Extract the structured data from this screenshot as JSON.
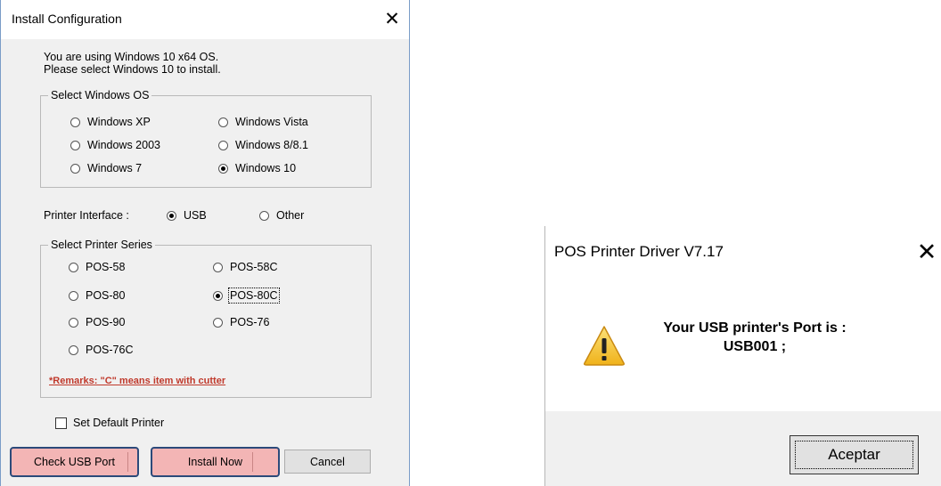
{
  "install_dialog": {
    "title": "Install Configuration",
    "close_glyph": "✕",
    "info_line1": "You are using Windows 10 x64 OS.",
    "info_line2": "Please select Windows 10 to install.",
    "os_group": {
      "legend": "Select Windows OS",
      "options": [
        {
          "label": "Windows XP",
          "selected": false
        },
        {
          "label": "Windows Vista",
          "selected": false
        },
        {
          "label": "Windows 2003",
          "selected": false
        },
        {
          "label": "Windows 8/8.1",
          "selected": false
        },
        {
          "label": "Windows 7",
          "selected": false
        },
        {
          "label": "Windows 10",
          "selected": true
        }
      ]
    },
    "printer_interface": {
      "label": "Printer Interface :",
      "options": [
        {
          "label": "USB",
          "selected": true
        },
        {
          "label": "Other",
          "selected": false
        }
      ]
    },
    "series_group": {
      "legend": "Select Printer Series",
      "options": [
        {
          "label": "POS-58",
          "selected": false
        },
        {
          "label": "POS-58C",
          "selected": false
        },
        {
          "label": "POS-80",
          "selected": false
        },
        {
          "label": "POS-80C",
          "selected": true
        },
        {
          "label": "POS-90",
          "selected": false
        },
        {
          "label": "POS-76",
          "selected": false
        },
        {
          "label": "POS-76C",
          "selected": false
        }
      ],
      "remark": "*Remarks: \"C\" means item with cutter"
    },
    "default_printer": {
      "label": "Set Default Printer",
      "checked": false
    },
    "buttons": {
      "check_usb": "Check USB Port",
      "install_now": "Install Now",
      "cancel": "Cancel"
    }
  },
  "driver_dialog": {
    "title": "POS Printer Driver V7.17",
    "close_glyph": "✕",
    "message_line1": "Your USB printer's Port is :",
    "message_line2": "USB001 ;",
    "icon": "warning-icon",
    "ok_label": "Aceptar"
  },
  "colors": {
    "highlight_fill": "#f3b5b5",
    "highlight_border": "#2c4a7a",
    "remark_text": "#c0392b",
    "warning_yellow": "#f7c531"
  }
}
